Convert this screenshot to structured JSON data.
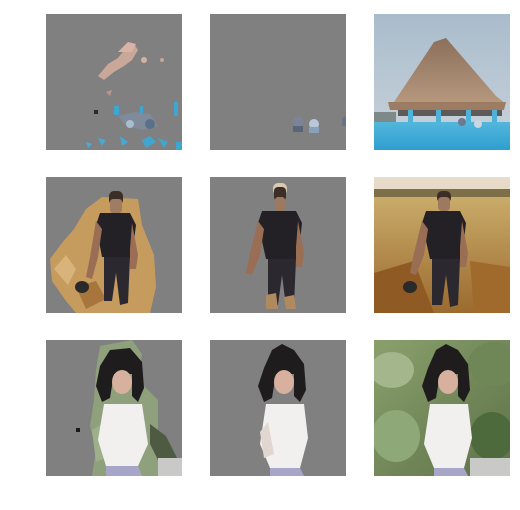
{
  "grid": {
    "rows": [
      {
        "subject": "thatched-hut-pool",
        "panels": [
          {
            "kind": "mask-prediction-a"
          },
          {
            "kind": "mask-prediction-b"
          },
          {
            "kind": "original-image"
          }
        ]
      },
      {
        "subject": "man-walking-field",
        "panels": [
          {
            "kind": "mask-prediction-a"
          },
          {
            "kind": "mask-prediction-b"
          },
          {
            "kind": "original-image"
          }
        ]
      },
      {
        "subject": "woman-foliage",
        "panels": [
          {
            "kind": "mask-prediction-a"
          },
          {
            "kind": "mask-prediction-b"
          },
          {
            "kind": "original-image"
          }
        ]
      }
    ]
  },
  "colors": {
    "background": "#ffffff",
    "mask_gray": "#808080"
  }
}
